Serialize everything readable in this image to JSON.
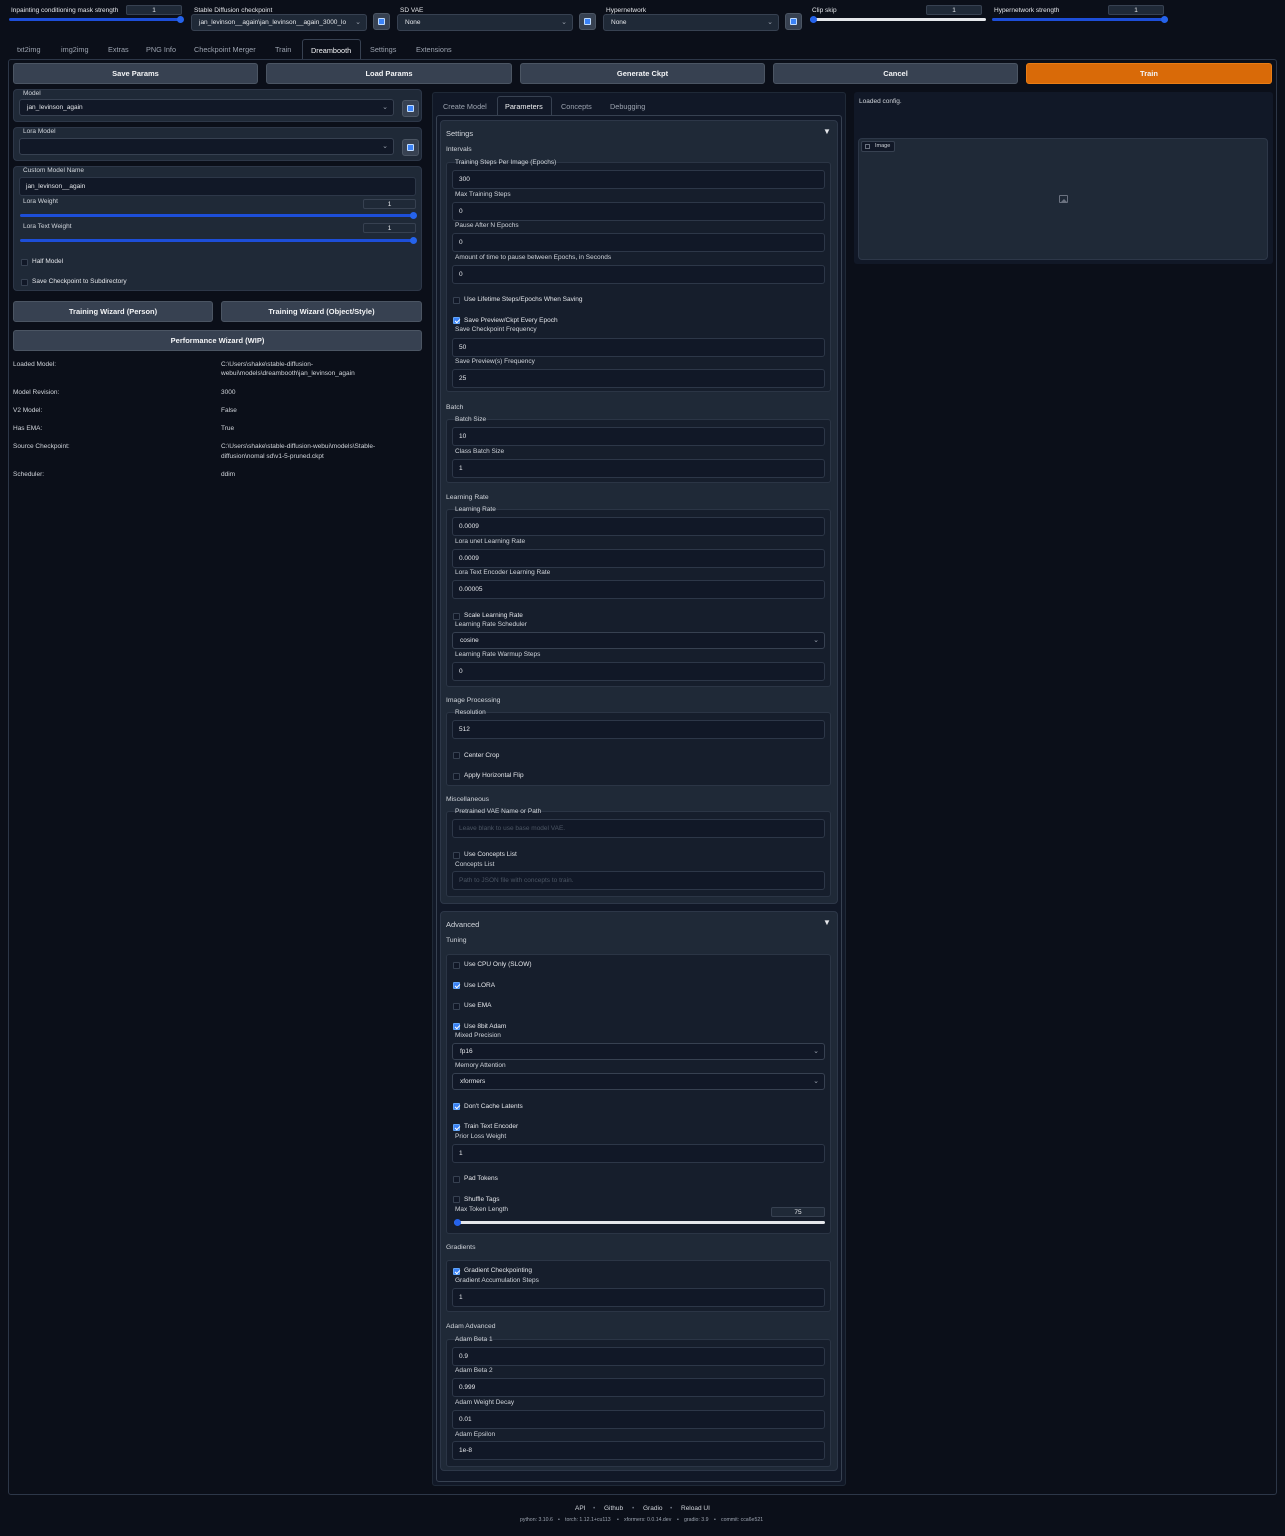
{
  "top": {
    "mask_strength": {
      "label": "Inpainting conditioning mask strength",
      "value": "1",
      "fraction": 1.0
    },
    "checkpoint": {
      "label": "Stable Diffusion checkpoint",
      "value": "jan_levinson__again\\jan_levinson__again_3000_lo"
    },
    "sd_vae": {
      "label": "SD VAE",
      "value": "None"
    },
    "hypernetwork": {
      "label": "Hypernetwork",
      "value": "None"
    },
    "clip_skip": {
      "label": "Clip skip",
      "value": "1",
      "fraction": 0.0
    },
    "hyper_strength": {
      "label": "Hypernetwork strength",
      "value": "1",
      "fraction": 1.0
    }
  },
  "tabs": [
    "txt2img",
    "img2img",
    "Extras",
    "PNG Info",
    "Checkpoint Merger",
    "Train",
    "Dreambooth",
    "Settings",
    "Extensions"
  ],
  "active_tab": "Dreambooth",
  "actions": {
    "save": "Save Params",
    "load": "Load Params",
    "generate": "Generate Ckpt",
    "cancel": "Cancel",
    "train": "Train"
  },
  "colors": {
    "accent": "#d96a08",
    "primary": "#2563eb",
    "bg": "#0b0f19"
  },
  "left": {
    "model_label": "Model",
    "model_value": "jan_levinson_again",
    "lora_label": "Lora Model",
    "lora_value": "",
    "custom_name_label": "Custom Model Name",
    "custom_name_value": "jan_levinson__again",
    "lora_weight_label": "Lora Weight",
    "lora_weight_value": "1",
    "lora_text_weight_label": "Lora Text Weight",
    "lora_text_weight_value": "1",
    "half_model": "Half Model",
    "save_subdir": "Save Checkpoint to Subdirectory",
    "wizard_person": "Training Wizard (Person)",
    "wizard_object": "Training Wizard (Object/Style)",
    "perf_wizard": "Performance Wizard (WIP)",
    "info": [
      {
        "k": "Loaded Model:",
        "v1": "C:\\Users\\shake\\stable-diffusion-",
        "v2": "webui\\models\\dreambooth\\jan_levinson_again"
      },
      {
        "k": "Model Revision:",
        "v1": "3000",
        "v2": ""
      },
      {
        "k": "V2 Model:",
        "v1": "False",
        "v2": ""
      },
      {
        "k": "Has EMA:",
        "v1": "True",
        "v2": ""
      },
      {
        "k": "Source Checkpoint:",
        "v1": "C:\\Users\\shake\\stable-diffusion-webui\\models\\Stable-",
        "v2": "diffusion\\nomal sd\\v1-5-pruned.ckpt"
      },
      {
        "k": "Scheduler:",
        "v1": "ddim",
        "v2": ""
      }
    ]
  },
  "subtabs": [
    "Create Model",
    "Parameters",
    "Concepts",
    "Debugging"
  ],
  "settings": {
    "title": "Settings",
    "intervals": "Intervals",
    "steps_per_image_label": "Training Steps Per Image (Epochs)",
    "steps_per_image": "300",
    "max_steps_label": "Max Training Steps",
    "max_steps": "0",
    "pause_epochs_label": "Pause After N Epochs",
    "pause_epochs": "0",
    "pause_seconds_label": "Amount of time to pause between Epochs, in Seconds",
    "pause_seconds": "0",
    "lifetime_label": "Use Lifetime Steps/Epochs When Saving",
    "save_preview_label": "Save Preview/Ckpt Every Epoch",
    "save_ckpt_freq_label": "Save Checkpoint Frequency",
    "save_ckpt_freq": "50",
    "save_preview_freq_label": "Save Preview(s) Frequency",
    "save_preview_freq": "25",
    "batch": "Batch",
    "batch_size_label": "Batch Size",
    "batch_size": "10",
    "class_batch_label": "Class Batch Size",
    "class_batch": "1",
    "lr_section": "Learning Rate",
    "lr_label": "Learning Rate",
    "lr": "0.0009",
    "lora_unet_lr_label": "Lora unet Learning Rate",
    "lora_unet_lr": "0.0009",
    "lora_te_lr_label": "Lora Text Encoder Learning Rate",
    "lora_te_lr": "0.00005",
    "scale_lr_label": "Scale Learning Rate",
    "lr_sched_label": "Learning Rate Scheduler",
    "lr_sched": "cosine",
    "warmup_label": "Learning Rate Warmup Steps",
    "warmup": "0",
    "img_proc": "Image Processing",
    "resolution_label": "Resolution",
    "resolution": "512",
    "center_crop_label": "Center Crop",
    "hflip_label": "Apply Horizontal Flip",
    "misc": "Miscellaneous",
    "vae_path_label": "Pretrained VAE Name or Path",
    "vae_path_ph": "Leave blank to use base model VAE.",
    "use_concepts_label": "Use Concepts List",
    "concepts_list_label": "Concepts List",
    "concepts_list_ph": "Path to JSON file with concepts to train."
  },
  "advanced": {
    "title": "Advanced",
    "tuning": "Tuning",
    "cpu_only": "Use CPU Only (SLOW)",
    "use_lora": "Use LORA",
    "use_ema": "Use EMA",
    "use_8bit": "Use 8bit Adam",
    "mixed_precision_label": "Mixed Precision",
    "mixed_precision": "fp16",
    "mem_attention_label": "Memory Attention",
    "mem_attention": "xformers",
    "dont_cache": "Don't Cache Latents",
    "train_te": "Train Text Encoder",
    "prior_loss_label": "Prior Loss Weight",
    "prior_loss": "1",
    "pad_tokens": "Pad Tokens",
    "shuffle_tags": "Shuffle Tags",
    "max_token_label": "Max Token Length",
    "max_token": "75",
    "max_token_fraction": 0.0,
    "gradients": "Gradients",
    "grad_ckpt": "Gradient Checkpointing",
    "grad_accum_label": "Gradient Accumulation Steps",
    "grad_accum": "1",
    "adam": "Adam Advanced",
    "beta1_label": "Adam Beta 1",
    "beta1": "0.9",
    "beta2_label": "Adam Beta 2",
    "beta2": "0.999",
    "wd_label": "Adam Weight Decay",
    "wd": "0.01",
    "eps_label": "Adam Epsilon",
    "eps": "1e-8"
  },
  "right": {
    "status": "Loaded config.",
    "image_label": "Image"
  },
  "footer": {
    "links": [
      "API",
      "Github",
      "Gradio",
      "Reload UI"
    ],
    "sep": "•",
    "python": "python: 3.10.6",
    "torch": "torch: 1.12.1+cu113",
    "xformers": "xformers: 0.0.14.dev",
    "gradio": "gradio: 3.9",
    "commit": "commit: cca6e521"
  }
}
